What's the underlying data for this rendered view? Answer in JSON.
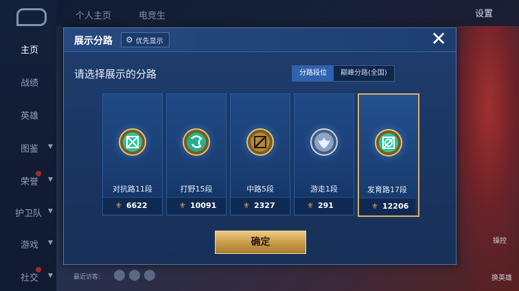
{
  "sidebar": {
    "items": [
      {
        "label": "主页",
        "active": true
      },
      {
        "label": "战绩"
      },
      {
        "label": "英雄"
      },
      {
        "label": "图鉴",
        "chevron": true
      },
      {
        "label": "荣誉",
        "chevron": true,
        "badge": true
      },
      {
        "label": "护卫队",
        "chevron": true
      },
      {
        "label": "游戏",
        "chevron": true
      },
      {
        "label": "社交",
        "chevron": true,
        "badge": true
      }
    ]
  },
  "topbar": {
    "tabs": [
      "个人主页",
      "电竞生"
    ],
    "settings": "设置"
  },
  "right_panel": {
    "button_top": "操控",
    "button_bottom": "换英雄"
  },
  "visitors_label": "最近访客:",
  "modal": {
    "title": "展示分路",
    "priority_label": "优先显示",
    "close_icon": "✕",
    "prompt": "请选择展示的分路",
    "toggle": {
      "active": "分路段位",
      "inactive": "巅峰分路(全国)"
    },
    "cards": [
      {
        "role": "对抗路11段",
        "score": "6622",
        "icon": "clash-lane-emblem-icon",
        "color": "#2fc49a",
        "selected": false
      },
      {
        "role": "打野15段",
        "score": "10091",
        "icon": "jungle-emblem-icon",
        "color": "#28b08c",
        "selected": false
      },
      {
        "role": "中路5段",
        "score": "2327",
        "icon": "mid-lane-emblem-icon",
        "color": "#b08a3a",
        "selected": false
      },
      {
        "role": "游走1段",
        "score": "291",
        "icon": "roam-emblem-icon",
        "color": "#8aa4c8",
        "selected": false
      },
      {
        "role": "发育路17段",
        "score": "12206",
        "icon": "farm-lane-emblem-icon",
        "color": "#2fc49a",
        "selected": true
      }
    ],
    "confirm_label": "确定"
  }
}
